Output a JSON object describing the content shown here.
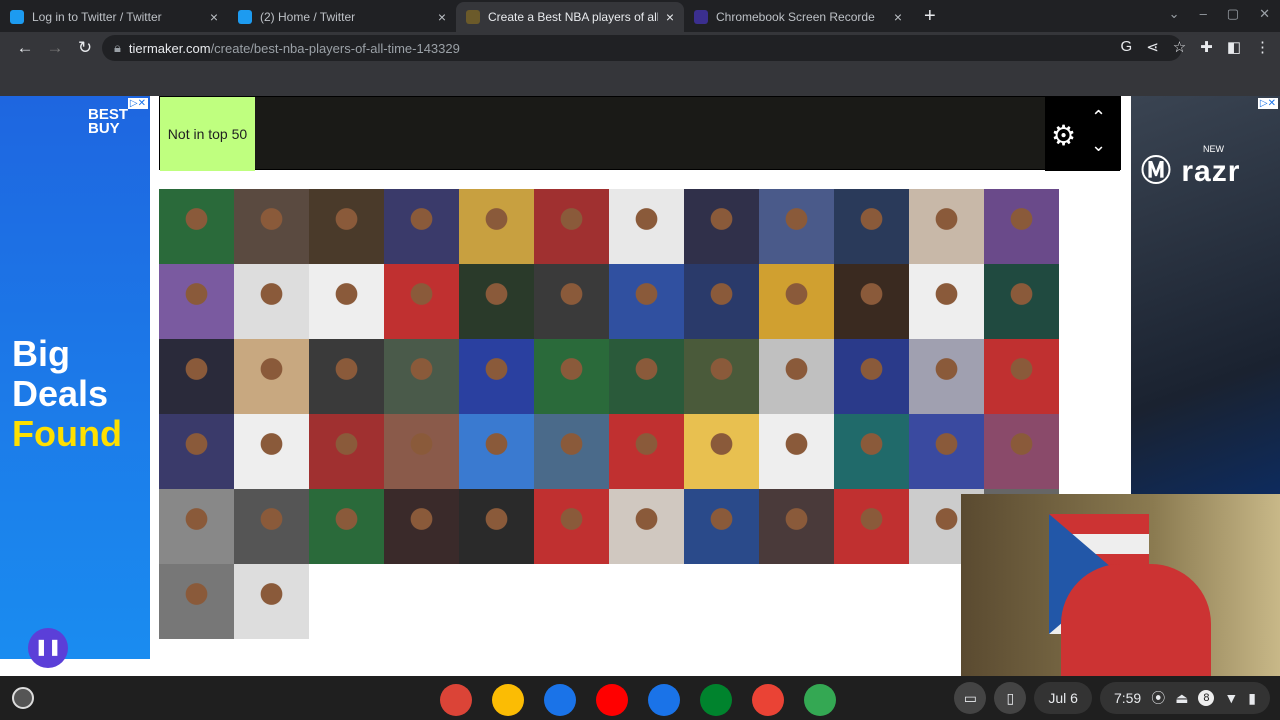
{
  "tabs": [
    {
      "title": "Log in to Twitter / Twitter",
      "favicon_color": "#1d9bf0",
      "active": false
    },
    {
      "title": "(2) Home / Twitter",
      "favicon_color": "#1d9bf0",
      "active": false
    },
    {
      "title": "Create a Best NBA players of all",
      "favicon_color": "#6b5a2a",
      "active": true
    },
    {
      "title": "Chromebook Screen Recorde",
      "favicon_color": "#3b2f8f",
      "active": false
    }
  ],
  "address": {
    "host": "tiermaker.com",
    "path": "/create/best-nba-players-of-all-time-143329"
  },
  "ad_left": {
    "brand": "BEST BUY",
    "line1": "Big",
    "line2": "Deals",
    "line3": "Found"
  },
  "ad_right": {
    "brand": "razr",
    "badge": "NEW",
    "maker": "motorola"
  },
  "tier": {
    "label": "Not in top 50"
  },
  "tiles": [
    "#2a6a3a",
    "#5a4a40",
    "#4a3a2a",
    "#3a3a6a",
    "#c8a040",
    "#a03030",
    "#e8e8e8",
    "#30304a",
    "#4a5a8a",
    "#2a3a5a",
    "#c8b8a8",
    "#6a4a8a",
    "#7a5aa0",
    "#ddd",
    "#eee",
    "#c03030",
    "#2a3a2a",
    "#3a3a3a",
    "#3050a0",
    "#2a3a6a",
    "#d0a030",
    "#3a2a20",
    "#eee",
    "#204a40",
    "#2a2a3a",
    "#c8a880",
    "#3a3a3a",
    "#4a5a4a",
    "#2a40a0",
    "#2a6a3a",
    "#2a5a3a",
    "#4a5a3a",
    "#c0c0c0",
    "#2a3a8a",
    "#a0a0b0",
    "#c03030",
    "#3a3a6a",
    "#eee",
    "#a03030",
    "#8a5a4a",
    "#3a7ad0",
    "#4a6a8a",
    "#c03030",
    "#e8c050",
    "#eee",
    "#206a6a",
    "#3a4aa0",
    "#8a4a6a",
    "#888",
    "#555",
    "#2a6a3a",
    "#3a2a2a",
    "#2a2a2a",
    "#c03030",
    "#d0c8c0",
    "#2a4a8a",
    "#4a3a3a",
    "#c03030",
    "#ccc",
    "#666",
    "#777",
    "#ddd"
  ],
  "shelf": {
    "apps": [
      {
        "name": "chrome",
        "color": "#db4437"
      },
      {
        "name": "photos",
        "color": "#fbbc04"
      },
      {
        "name": "files",
        "color": "#1a73e8"
      },
      {
        "name": "youtube",
        "color": "#ff0000"
      },
      {
        "name": "messages",
        "color": "#1a73e8"
      },
      {
        "name": "meet",
        "color": "#00832d"
      },
      {
        "name": "gmail",
        "color": "#ea4335"
      },
      {
        "name": "play-store",
        "color": "#34a853"
      }
    ],
    "date": "Jul 6",
    "time": "7:59",
    "notifications": "8"
  }
}
